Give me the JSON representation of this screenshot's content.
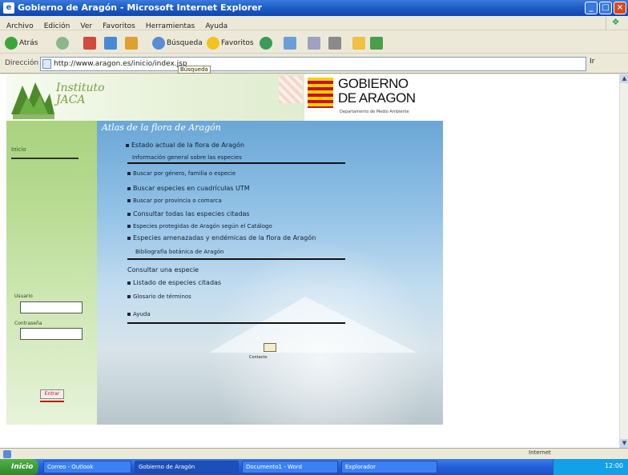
{
  "window": {
    "title": "Gobierno de Aragón - Microsoft Internet Explorer",
    "controls": [
      "_",
      "□",
      "×"
    ]
  },
  "menu": [
    "Archivo",
    "Edición",
    "Ver",
    "Favoritos",
    "Herramientas",
    "Ayuda"
  ],
  "toolbar": {
    "back": "Atrás",
    "search": "Búsqueda",
    "favorites": "Favoritos"
  },
  "address": {
    "label": "Dirección",
    "url": "http://www.aragon.es/inicio/index.jsp",
    "go": "Ir",
    "tooltip": "Búsqueda"
  },
  "site": {
    "logo_line1": "Instituto",
    "logo_line2": "JACA",
    "gov_title_1": "GOBIERNO",
    "gov_title_2": "DE ARAGON",
    "gov_sub": "Departamento de Medio Ambiente"
  },
  "sidebar": {
    "nav_item": "Inicio",
    "user_label": "Usuario",
    "pass_label": "Contraseña",
    "submit": "Entrar"
  },
  "main": {
    "title": "Atlas de la flora de Aragón",
    "lines": [
      "Estado actual de la flora de Aragón",
      "Información general sobre las especies",
      "Buscar por género, familia o especie",
      "Buscar especies en cuadrículas UTM",
      "Buscar por provincia o comarca",
      "Consultar todas las especies citadas",
      "Especies protegidas de Aragón según el Catálogo",
      "Especies amenazadas y endémicas de la flora de Aragón",
      "Bibliografía botánica de Aragón",
      "Consultar una especie",
      "Listado de especies citadas",
      "Glosario de términos",
      "Ayuda"
    ],
    "mail_label": "Contacto"
  },
  "status": {
    "zone": "Internet"
  },
  "taskbar": {
    "start": "Inicio",
    "tasks": [
      "Correo - Outlook",
      "Gobierno de Aragón",
      "Documento1 - Word",
      "Explorador"
    ],
    "clock": "12:00"
  }
}
